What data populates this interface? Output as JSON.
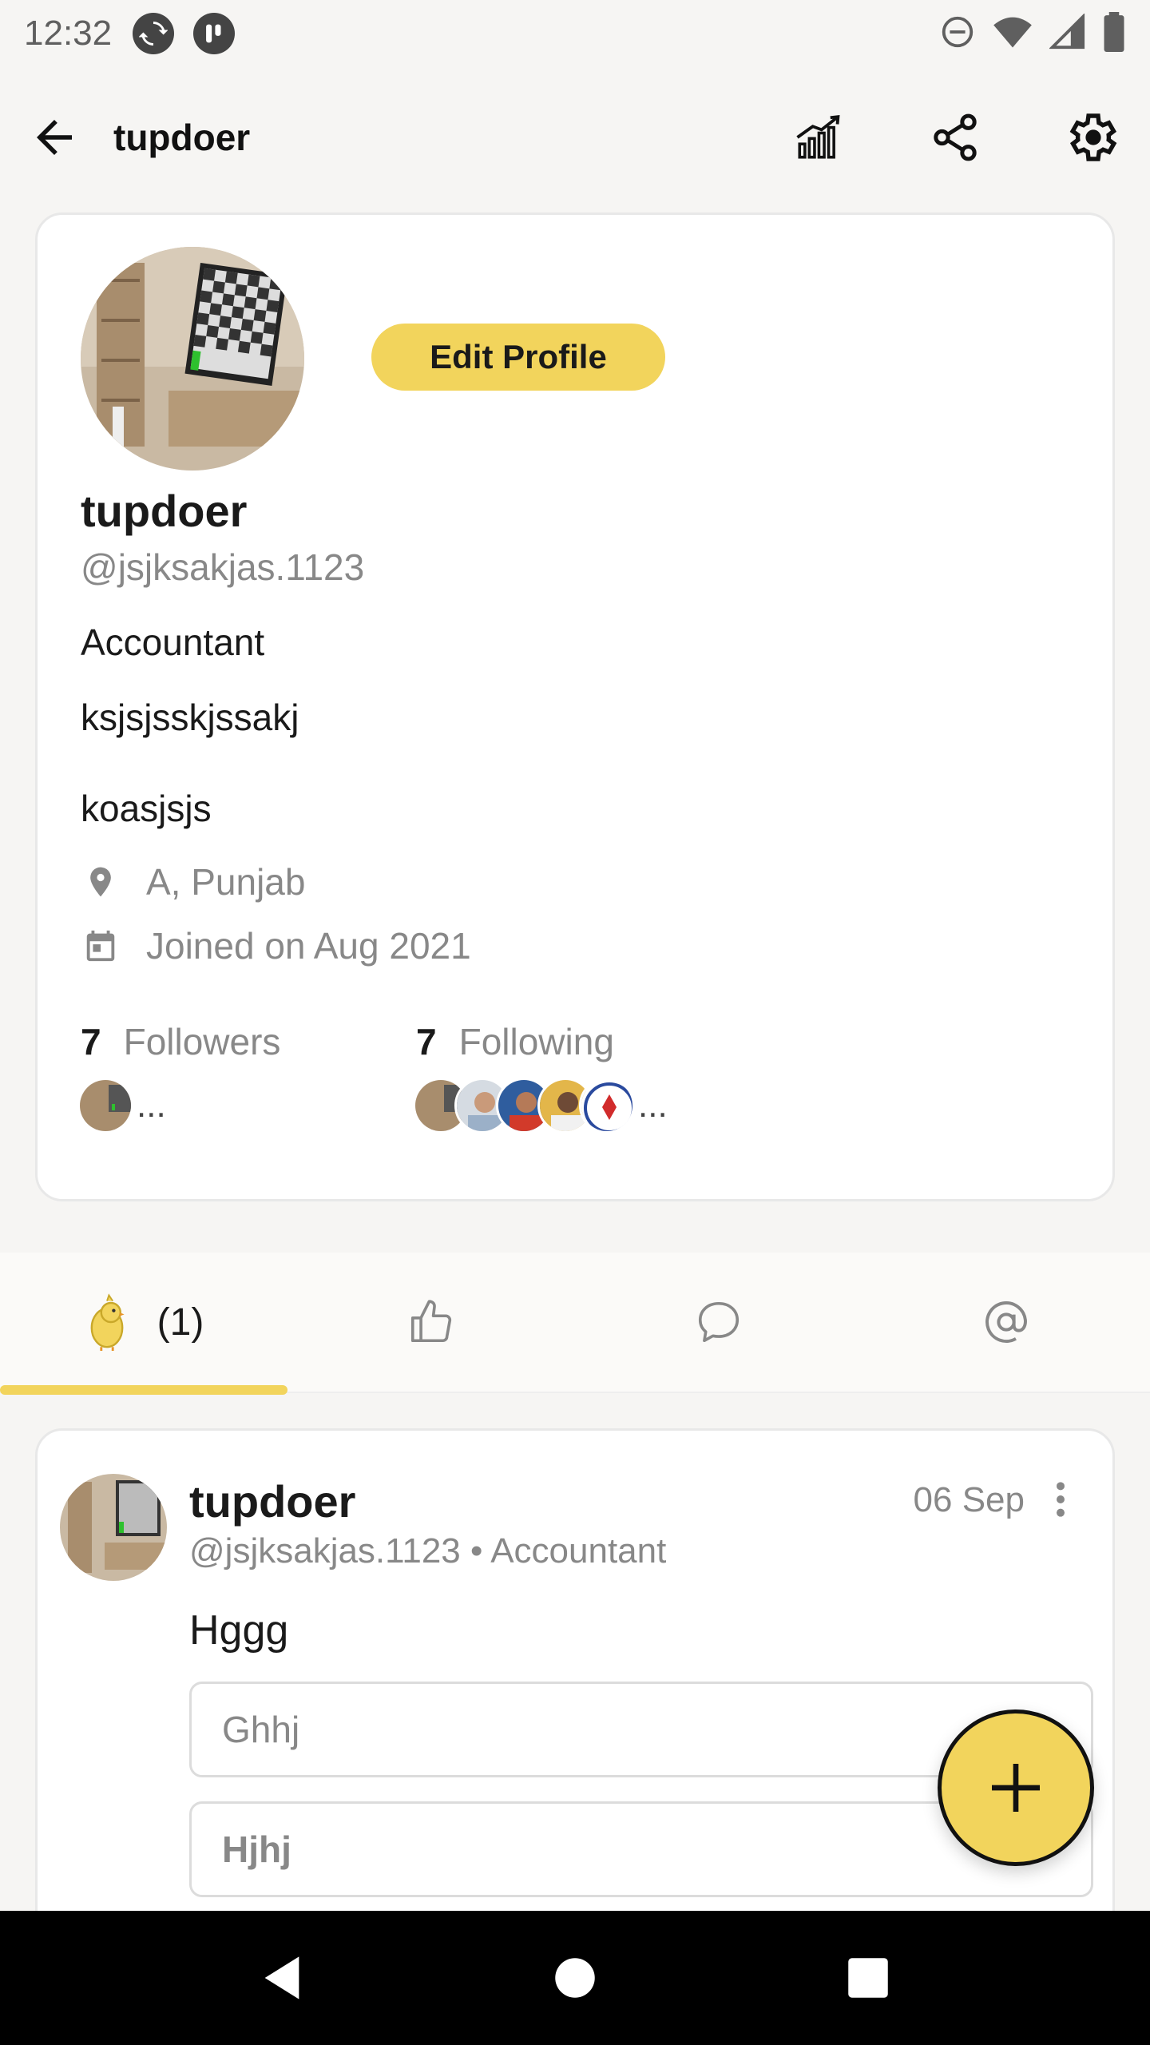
{
  "status_bar": {
    "time": "12:32"
  },
  "header": {
    "title": "tupdoer"
  },
  "profile": {
    "edit_button_label": "Edit Profile",
    "name": "tupdoer",
    "handle": "@jsjksakjas.1123",
    "occupation": "Accountant",
    "bio_line1": "ksjsjsskjssakj",
    "bio_line2": "koasjsjs",
    "location": "A, Punjab",
    "joined": "Joined on Aug 2021",
    "followers_count": "7",
    "followers_label": "Followers",
    "following_count": "7",
    "following_label": "Following",
    "ellipsis": "..."
  },
  "tabs": {
    "posts_count": "(1)"
  },
  "post": {
    "author_name": "tupdoer",
    "author_meta": "@jsjksakjas.1123 • Accountant",
    "date": "06 Sep",
    "text": "Hggg",
    "poll_options": [
      "Ghhj",
      "Hjhj"
    ]
  },
  "colors": {
    "accent": "#f2d45c",
    "background": "#f6f5f3",
    "card": "#ffffff",
    "muted_text": "#888888"
  },
  "icons": {
    "status": [
      "sync-icon",
      "app-icon",
      "dnd-icon",
      "wifi-icon",
      "signal-icon",
      "battery-icon"
    ],
    "header": [
      "back-arrow-icon",
      "stats-icon",
      "share-icon",
      "settings-icon"
    ],
    "tabs": [
      "bird-icon",
      "thumbs-up-icon",
      "comment-icon",
      "at-icon"
    ],
    "nav": [
      "back-triangle-icon",
      "home-circle-icon",
      "recents-square-icon"
    ]
  }
}
